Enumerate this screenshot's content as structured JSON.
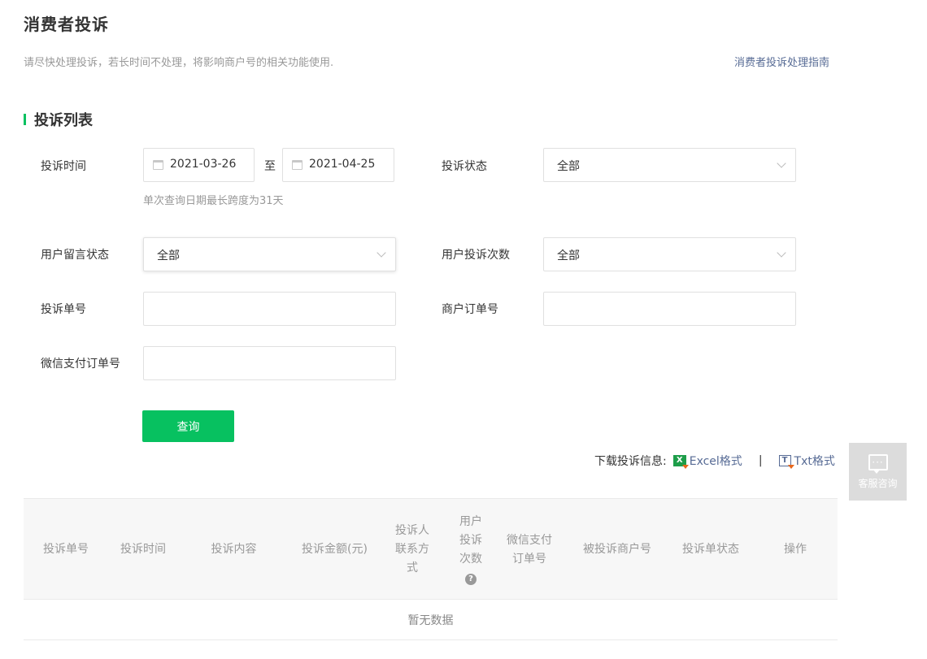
{
  "page": {
    "title": "消费者投诉",
    "notice": "请尽快处理投诉，若长时间不处理，将影响商户号的相关功能使用.",
    "guide_link": "消费者投诉处理指南"
  },
  "section": {
    "title": "投诉列表"
  },
  "filters": {
    "complaint_time_label": "投诉时间",
    "start_date": "2021-03-26",
    "to_text": "至",
    "end_date": "2021-04-25",
    "date_hint": "单次查询日期最长跨度为31天",
    "complaint_status_label": "投诉状态",
    "complaint_status_value": "全部",
    "user_message_status_label": "用户留言状态",
    "user_message_status_value": "全部",
    "user_complaint_count_label": "用户投诉次数",
    "user_complaint_count_value": "全部",
    "complaint_no_label": "投诉单号",
    "complaint_no_value": "",
    "merchant_order_label": "商户订单号",
    "merchant_order_value": "",
    "wechat_order_label": "微信支付订单号",
    "wechat_order_value": "",
    "query_button": "查询"
  },
  "download": {
    "label": "下载投诉信息:",
    "excel_label": "Excel格式",
    "separator": "|",
    "txt_label": "Txt格式",
    "excel_icon_text": "X",
    "txt_icon_text": "T"
  },
  "service": {
    "label": "客服咨询",
    "icon_text": "···"
  },
  "table": {
    "columns": {
      "complaint_no": "投诉单号",
      "complaint_time": "投诉时间",
      "content": "投诉内容",
      "amount": "投诉金额(元)",
      "contact": [
        "投诉人",
        "联系方",
        "式"
      ],
      "user_count": [
        "用户",
        "投诉",
        "次数"
      ],
      "wechat_order": [
        "微信支付",
        "订单号"
      ],
      "merchant": "被投诉商户号",
      "status": "投诉单状态",
      "action": "操作"
    },
    "help_icon": "?",
    "empty_text": "暂无数据"
  },
  "colors": {
    "accent": "#07c160",
    "link": "#576b95",
    "muted": "#999999"
  },
  "icons": [
    "calendar-icon",
    "chevron-down-icon",
    "excel-icon",
    "txt-icon",
    "chat-bubble-icon",
    "help-icon"
  ]
}
